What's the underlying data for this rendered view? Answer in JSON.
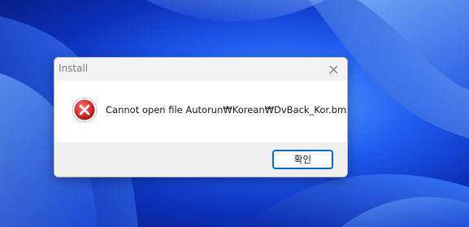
{
  "window": {
    "title": "Install"
  },
  "dialog": {
    "icon": "error-icon",
    "message": "Cannot open file Autorun₩Korean₩DvBack_Kor.bmp.",
    "ok_label": "확인",
    "close_icon": "close-icon"
  },
  "colors": {
    "accent": "#0067c0",
    "error_red": "#d32f2f",
    "desktop_blue": "#1f5cf0"
  }
}
